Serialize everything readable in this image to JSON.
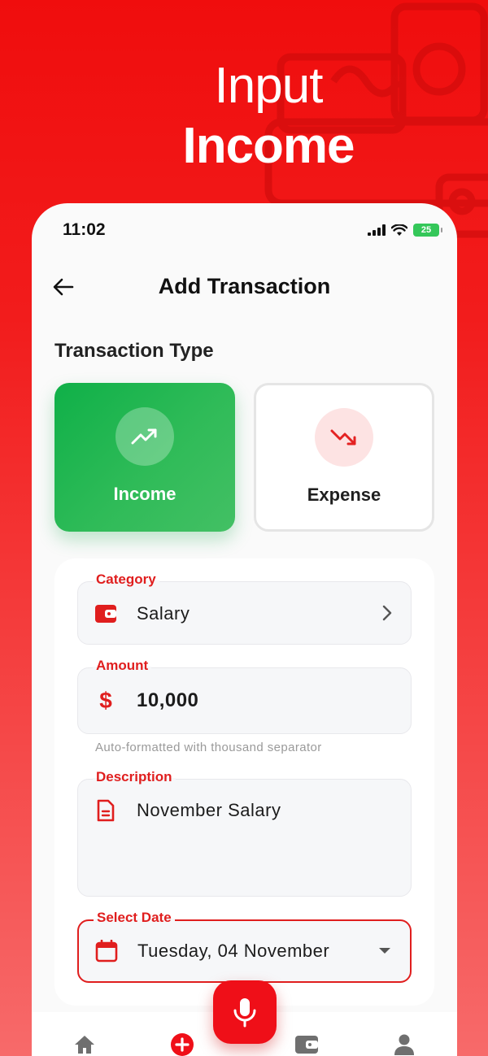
{
  "promo": {
    "line1": "Input",
    "line2": "Income"
  },
  "status_bar": {
    "time": "11:02",
    "battery": "25"
  },
  "app_bar": {
    "title": "Add Transaction"
  },
  "transaction_type": {
    "title": "Transaction Type",
    "options": [
      {
        "label": "Income",
        "selected": true
      },
      {
        "label": "Expense",
        "selected": false
      }
    ]
  },
  "form": {
    "category": {
      "label": "Category",
      "value": "Salary"
    },
    "amount": {
      "label": "Amount",
      "value": "10,000",
      "helper": "Auto-formatted with thousand separator"
    },
    "description": {
      "label": "Description",
      "value": "November Salary"
    },
    "date": {
      "label": "Select Date",
      "value": "Tuesday, 04 November"
    }
  },
  "bottom_nav": {
    "items": [
      "home-icon",
      "add-circle-icon",
      "wallet-icon",
      "person-icon"
    ],
    "fab": "mic-icon"
  },
  "colors": {
    "brand_red": "#ef0f18",
    "income_green": "#1fb350",
    "label_red": "#e01e1e"
  }
}
